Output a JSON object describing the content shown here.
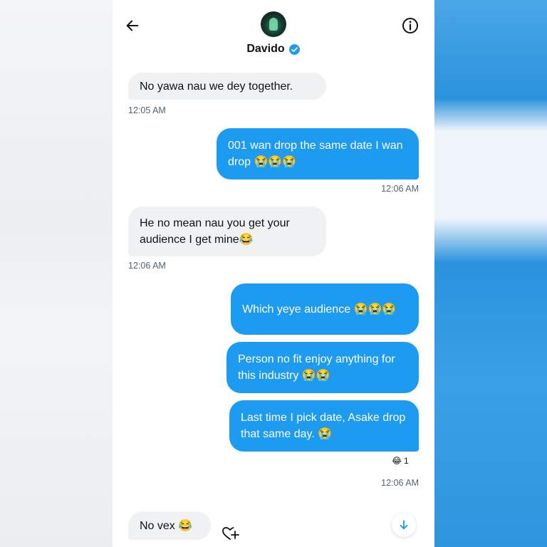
{
  "header": {
    "contact_name": "Davido",
    "verified_color": "#1d9bf0"
  },
  "messages": [
    {
      "side": "received",
      "text": "No yawa nau we dey together."
    },
    {
      "side": "sent",
      "text": "001 wan drop the same date I wan drop 😭😭😭"
    },
    {
      "side": "received",
      "text": "He no mean nau you get your audience I get mine😂"
    },
    {
      "side": "sent",
      "text": "Which yeye audience 😭😭😭"
    },
    {
      "side": "sent",
      "text": "Person no fit enjoy anything for this industry 😭😭"
    },
    {
      "side": "sent",
      "text": "Last time I pick date, Asake drop that same day. 😭"
    },
    {
      "side": "received",
      "text": "No vex 😂"
    }
  ],
  "timestamps": {
    "t1": "12:05 AM",
    "t2": "12:06 AM",
    "t3": "12:06 AM",
    "t4": "12:06 AM"
  },
  "reaction": {
    "emoji": "😂",
    "count": "1"
  },
  "icons": {
    "back": "arrow-left-icon",
    "info": "info-icon",
    "verified": "verified-badge-icon",
    "add_reaction": "heart-plus-icon",
    "scroll": "arrow-down-icon"
  },
  "colors": {
    "sent_bubble": "#1d9bf0",
    "received_bubble": "#eff1f3",
    "timestamp": "#536471"
  }
}
